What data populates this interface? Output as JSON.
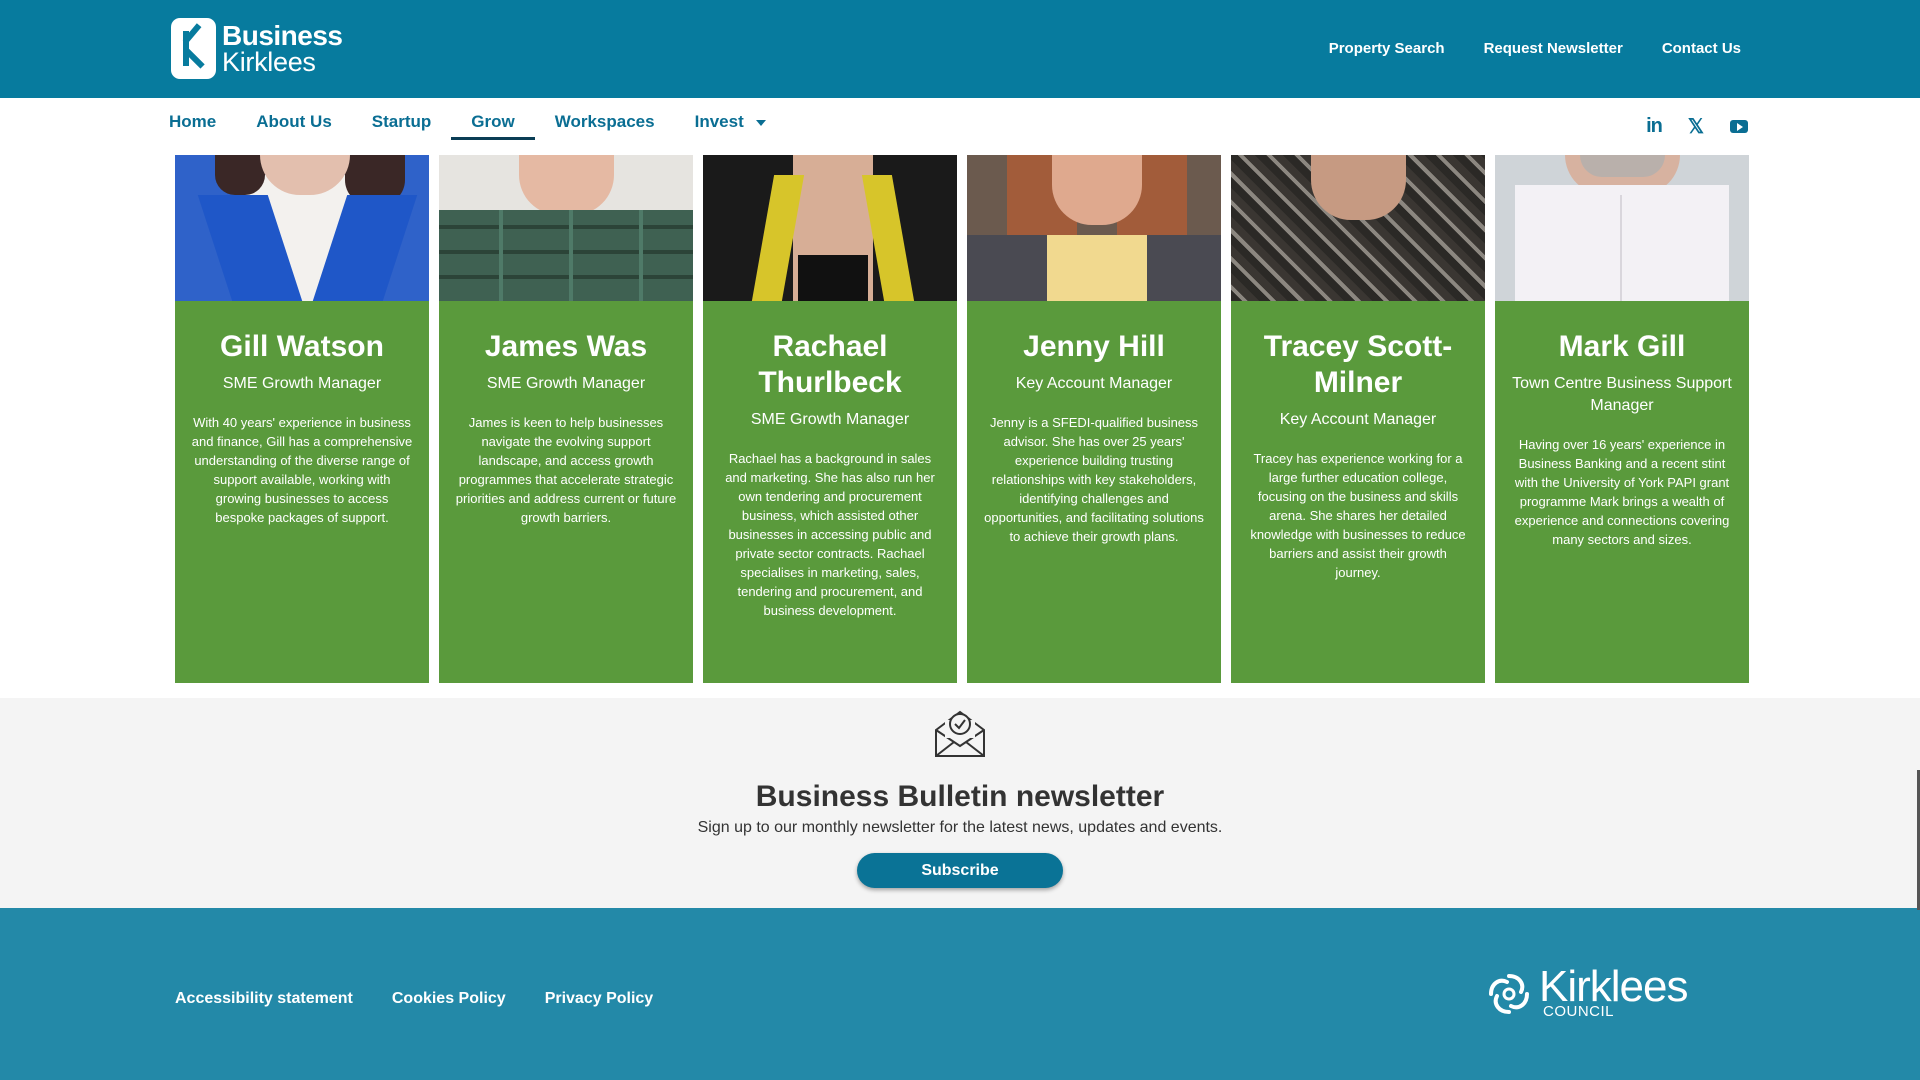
{
  "header": {
    "logo_line1": "Business",
    "logo_line2": "Kirklees",
    "top_links": [
      "Property Search",
      "Request Newsletter",
      "Contact Us"
    ]
  },
  "nav": {
    "items": [
      "Home",
      "About Us",
      "Startup",
      "Grow",
      "Workspaces",
      "Invest"
    ],
    "active": "Grow",
    "social_icons": [
      "linkedin-icon",
      "x-icon",
      "youtube-icon"
    ]
  },
  "team": [
    {
      "name": "Gill Watson",
      "role": "SME Growth Manager",
      "description": "With 40 years' experience in business and finance, Gill has a comprehensive understanding of the diverse range of support available, working with growing businesses to access bespoke packages of support."
    },
    {
      "name": "James Was",
      "role": "SME Growth Manager",
      "description": "James is keen to help businesses navigate the evolving support landscape, and access growth programmes that accelerate strategic priorities and address current or future growth barriers."
    },
    {
      "name": "Rachael Thurlbeck",
      "role": "SME Growth Manager",
      "description": "Rachael has a background in sales and marketing.  She has also run her own tendering and procurement business, which assisted other businesses in accessing public and private sector contracts. Rachael specialises in marketing, sales, tendering and procurement, and business development."
    },
    {
      "name": "Jenny Hill",
      "role": "Key Account Manager",
      "description": "Jenny is a SFEDI-qualified business advisor.  She has over 25 years' experience building trusting relationships with key stakeholders, identifying challenges and opportunities, and facilitating solutions to achieve their growth plans."
    },
    {
      "name": "Tracey Scott-Milner",
      "role": "Key Account Manager",
      "description": "Tracey has experience working for a large further education college, focusing on the business and skills arena.  She shares her detailed knowledge with businesses to reduce barriers and assist their growth journey."
    },
    {
      "name": "Mark Gill",
      "role": "Town Centre Business Support Manager",
      "description": "Having over 16 years' experience in Business Banking and a recent stint with the University of York PAPI grant programme Mark brings a wealth of experience and connections covering many sectors and sizes."
    }
  ],
  "newsletter": {
    "title": "Business Bulletin newsletter",
    "subtitle": "Sign up to our monthly newsletter for the latest news, updates and events.",
    "button": "Subscribe"
  },
  "footer": {
    "links": [
      "Accessibility statement",
      "Cookies Policy",
      "Privacy Policy"
    ],
    "logo_name": "Kirklees",
    "logo_sub": "COUNCIL"
  },
  "colors": {
    "header_blue": "#077b9e",
    "card_green": "#5a9a3c",
    "footer_blue": "#2389a8",
    "nav_text": "#0a6e93"
  }
}
